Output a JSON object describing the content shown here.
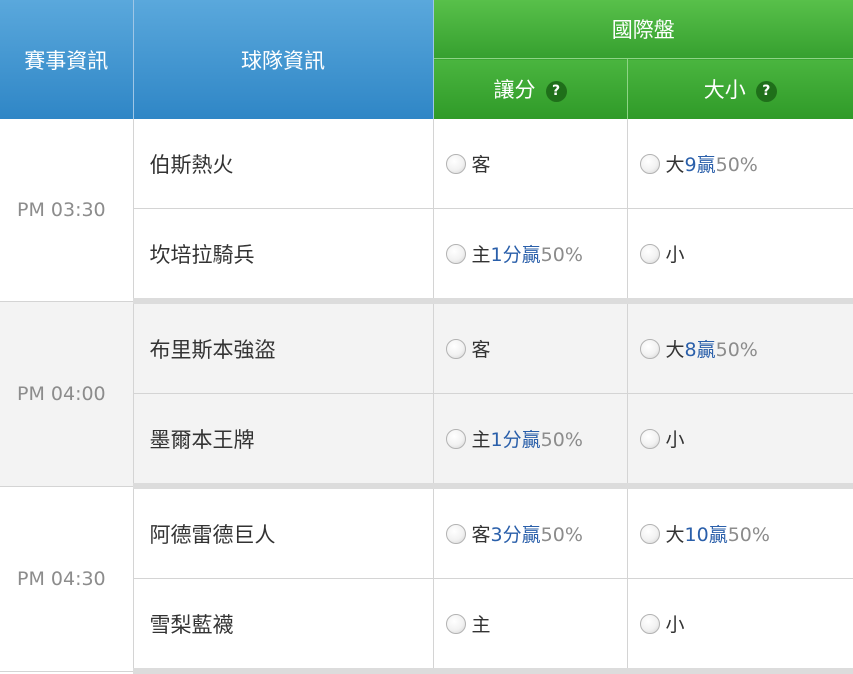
{
  "header": {
    "match_info": "賽事資訊",
    "team_info": "球隊資訊",
    "market": "國際盤",
    "handicap": "讓分",
    "over_under": "大小",
    "help_symbol": "?"
  },
  "matches": [
    {
      "time": "PM 03:30",
      "teams": [
        {
          "name": "伯斯熱火",
          "hand": {
            "side": "客",
            "line": "",
            "unit": "",
            "win": "",
            "pct": ""
          },
          "ou": {
            "side": "大",
            "line": "9",
            "win": "贏",
            "pct": "50%"
          }
        },
        {
          "name": "坎培拉騎兵",
          "hand": {
            "side": "主",
            "line": "1",
            "unit": "分",
            "win": "贏",
            "pct": "50%"
          },
          "ou": {
            "side": "小",
            "line": "",
            "win": "",
            "pct": ""
          }
        }
      ]
    },
    {
      "time": "PM 04:00",
      "teams": [
        {
          "name": "布里斯本強盜",
          "hand": {
            "side": "客",
            "line": "",
            "unit": "",
            "win": "",
            "pct": ""
          },
          "ou": {
            "side": "大",
            "line": "8",
            "win": "贏",
            "pct": "50%"
          }
        },
        {
          "name": "墨爾本王牌",
          "hand": {
            "side": "主",
            "line": "1",
            "unit": "分",
            "win": "贏",
            "pct": "50%"
          },
          "ou": {
            "side": "小",
            "line": "",
            "win": "",
            "pct": ""
          }
        }
      ]
    },
    {
      "time": "PM 04:30",
      "teams": [
        {
          "name": "阿德雷德巨人",
          "hand": {
            "side": "客",
            "line": "3",
            "unit": "分",
            "win": "贏",
            "pct": "50%"
          },
          "ou": {
            "side": "大",
            "line": "10",
            "win": "贏",
            "pct": "50%"
          }
        },
        {
          "name": "雪梨藍襪",
          "hand": {
            "side": "主",
            "line": "",
            "unit": "",
            "win": "",
            "pct": ""
          },
          "ou": {
            "side": "小",
            "line": "",
            "win": "",
            "pct": ""
          }
        }
      ]
    }
  ],
  "colors": {
    "header_blue": "#3a8fcd",
    "header_green": "#3aa832",
    "line_value_blue": "#2a5faa",
    "muted_gray": "#8c8c8c"
  }
}
